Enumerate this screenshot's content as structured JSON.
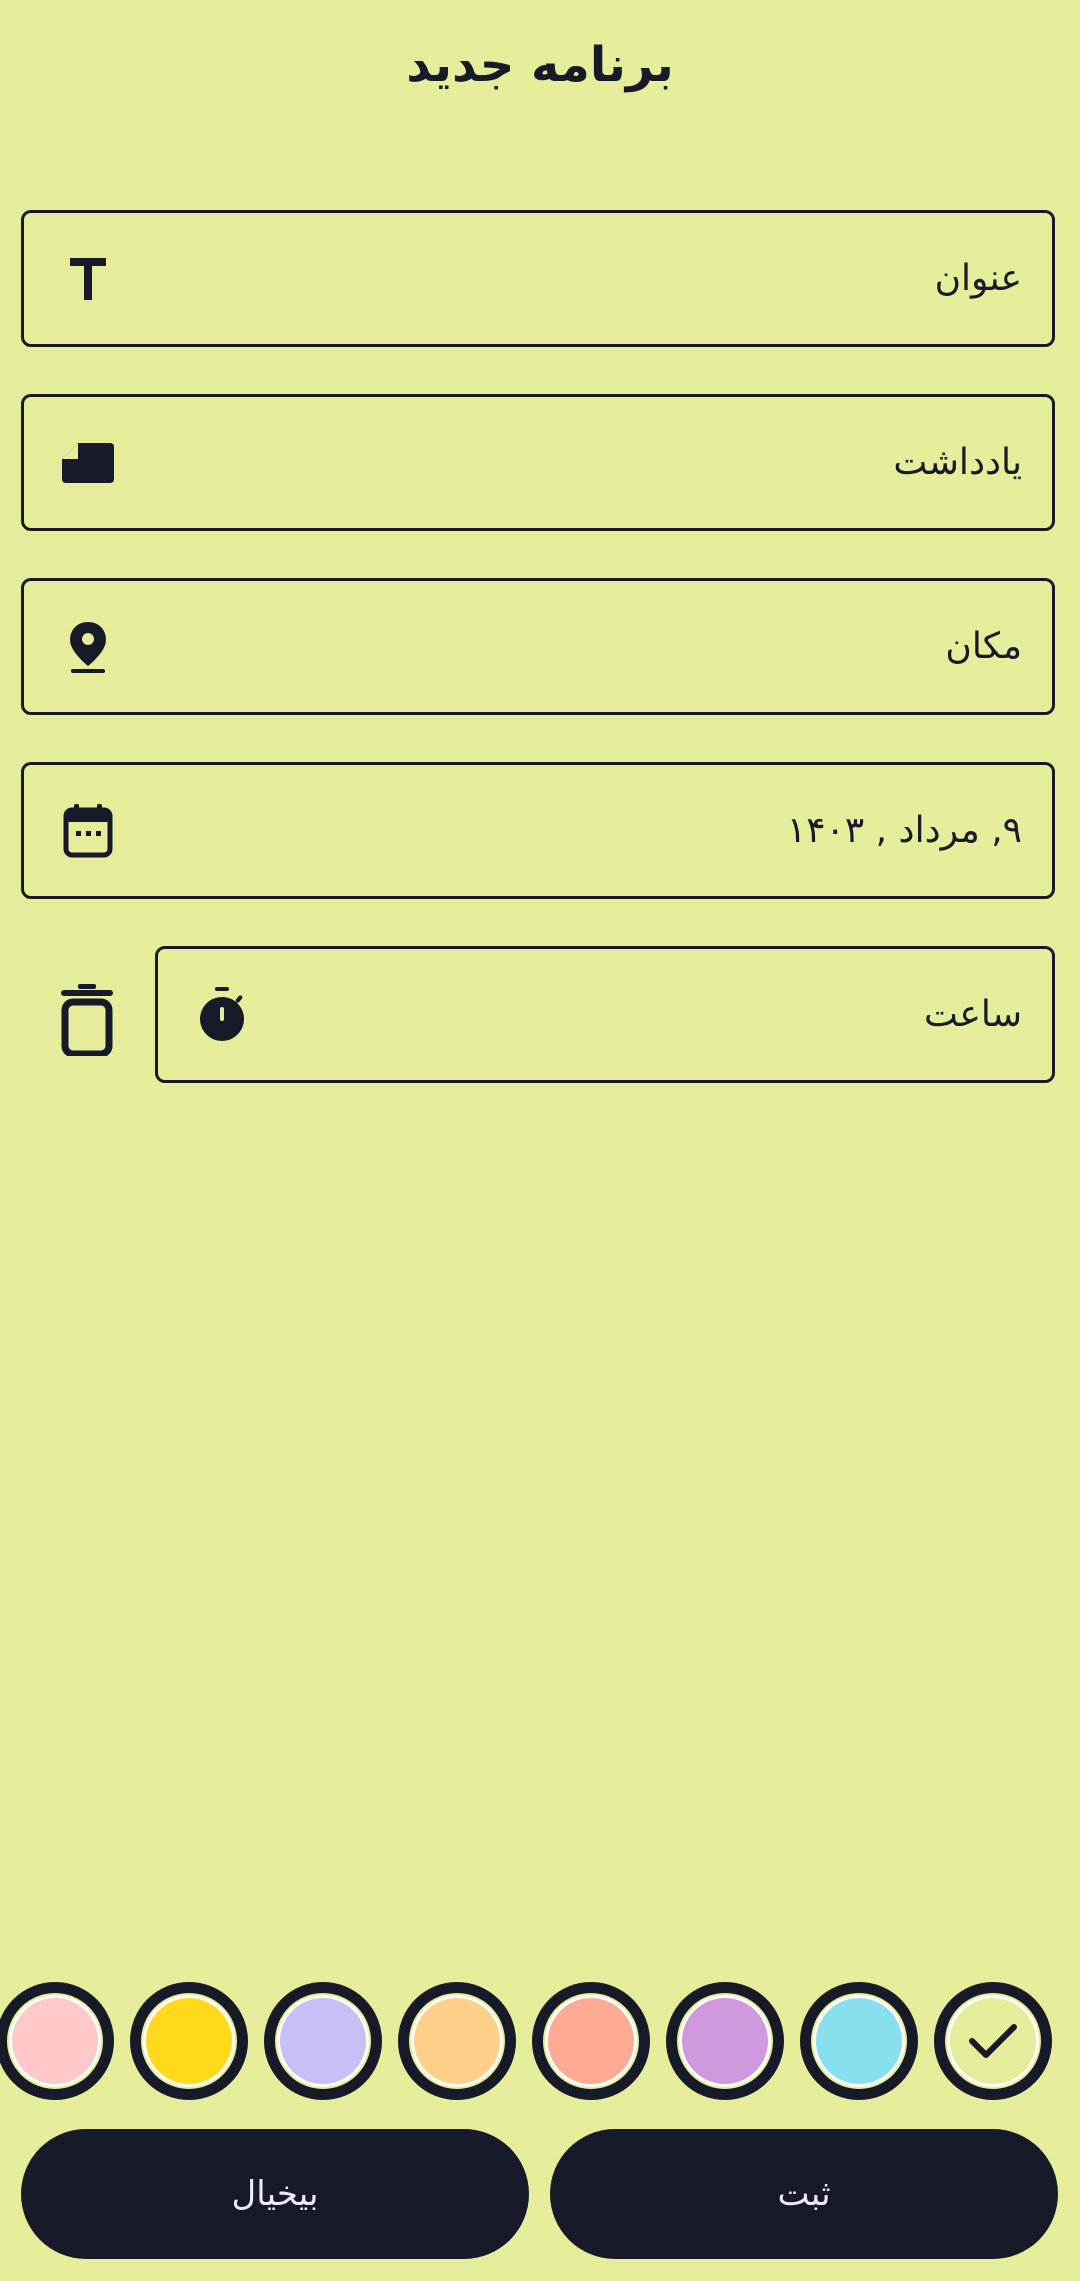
{
  "header": {
    "title": "برنامه جدید"
  },
  "fields": {
    "title": {
      "placeholder": "عنوان",
      "icon": "text-icon"
    },
    "note": {
      "placeholder": "یادداشت",
      "icon": "note-icon"
    },
    "location": {
      "placeholder": "مکان",
      "icon": "location-pin-icon"
    },
    "date": {
      "value": "۹, مرداد , ۱۴۰۳",
      "icon": "calendar-icon"
    },
    "time": {
      "placeholder": "ساعت",
      "icon": "stopwatch-icon"
    }
  },
  "delete_time": {
    "icon": "trash-icon"
  },
  "colors": {
    "swatches": [
      "#ffc9c9",
      "#ffd91a",
      "#c5c0f5",
      "#ffd08a",
      "#ffab93",
      "#d099dd",
      "#88e0ee",
      "#e5ed9a"
    ],
    "selected": "#e5ed9a",
    "selected_icon": "checkmark-icon"
  },
  "actions": {
    "cancel": "بیخیال",
    "submit": "ثبت"
  },
  "theme": {
    "background": "#e5ed9a",
    "dark": "#171b29"
  }
}
